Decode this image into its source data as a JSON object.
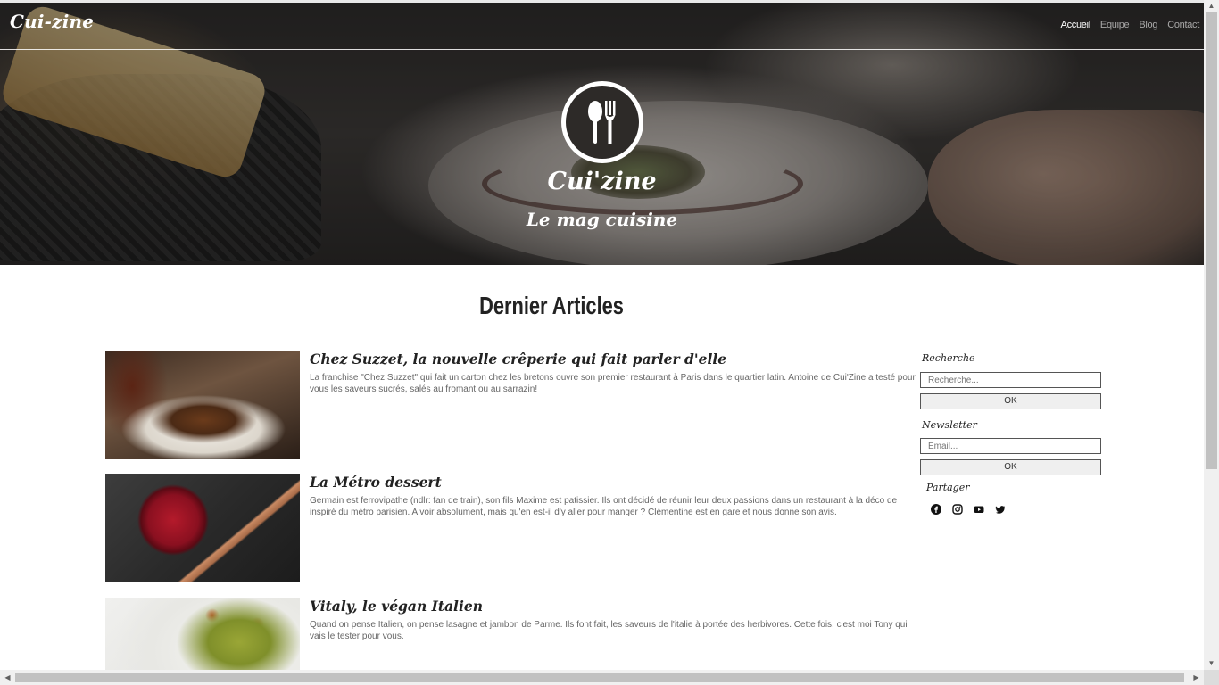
{
  "navbar": {
    "brand": "Cui-zine",
    "links": [
      "Accueil",
      "Equipe",
      "Blog",
      "Contact"
    ],
    "active": "Accueil"
  },
  "hero": {
    "logo_icon": "spoon-fork-icon",
    "title": "Cui'zine",
    "subtitle": "Le mag cuisine"
  },
  "main": {
    "section_title": "Dernier Articles",
    "articles": [
      {
        "title": "Chez Suzzet, la nouvelle crêperie qui fait parler d'elle",
        "text": "La franchise \"Chez Suzzet\" qui fait un carton chez les bretons ouvre son premier restaurant à Paris dans le quartier latin. Antoine de Cui'Zine a testé pour vous les saveurs sucrés, salés au fromant ou au sarrazin!"
      },
      {
        "title": "La Métro dessert",
        "text": "Germain est ferrovipathe (ndlr: fan de train), son fils Maxime est patissier. Ils ont décidé de réunir leur deux passions dans un restaurant à la déco de inspiré du métro parisien. A voir absolument, mais qu'en est-il d'y aller pour manger ? Clémentine est en gare et nous donne son avis."
      },
      {
        "title": "Vitaly, le végan Italien",
        "text": "Quand on pense Italien, on pense lasagne et jambon de Parme. Ils font fait, les saveurs de l'italie à portée des herbivores. Cette fois, c'est moi Tony qui vais le tester pour vous."
      }
    ]
  },
  "sidebar": {
    "search_label": "Recherche",
    "search_placeholder": "Recherche...",
    "search_button": "OK",
    "newsletter_label": "Newsletter",
    "email_placeholder": "Email...",
    "newsletter_button": "OK",
    "share_label": "Partager",
    "social_icons": [
      "facebook-icon",
      "instagram-icon",
      "youtube-icon",
      "twitter-icon"
    ]
  },
  "colors": {
    "text": "#222222",
    "muted_text": "#666666",
    "hero_overlay": "#2d2a28"
  }
}
